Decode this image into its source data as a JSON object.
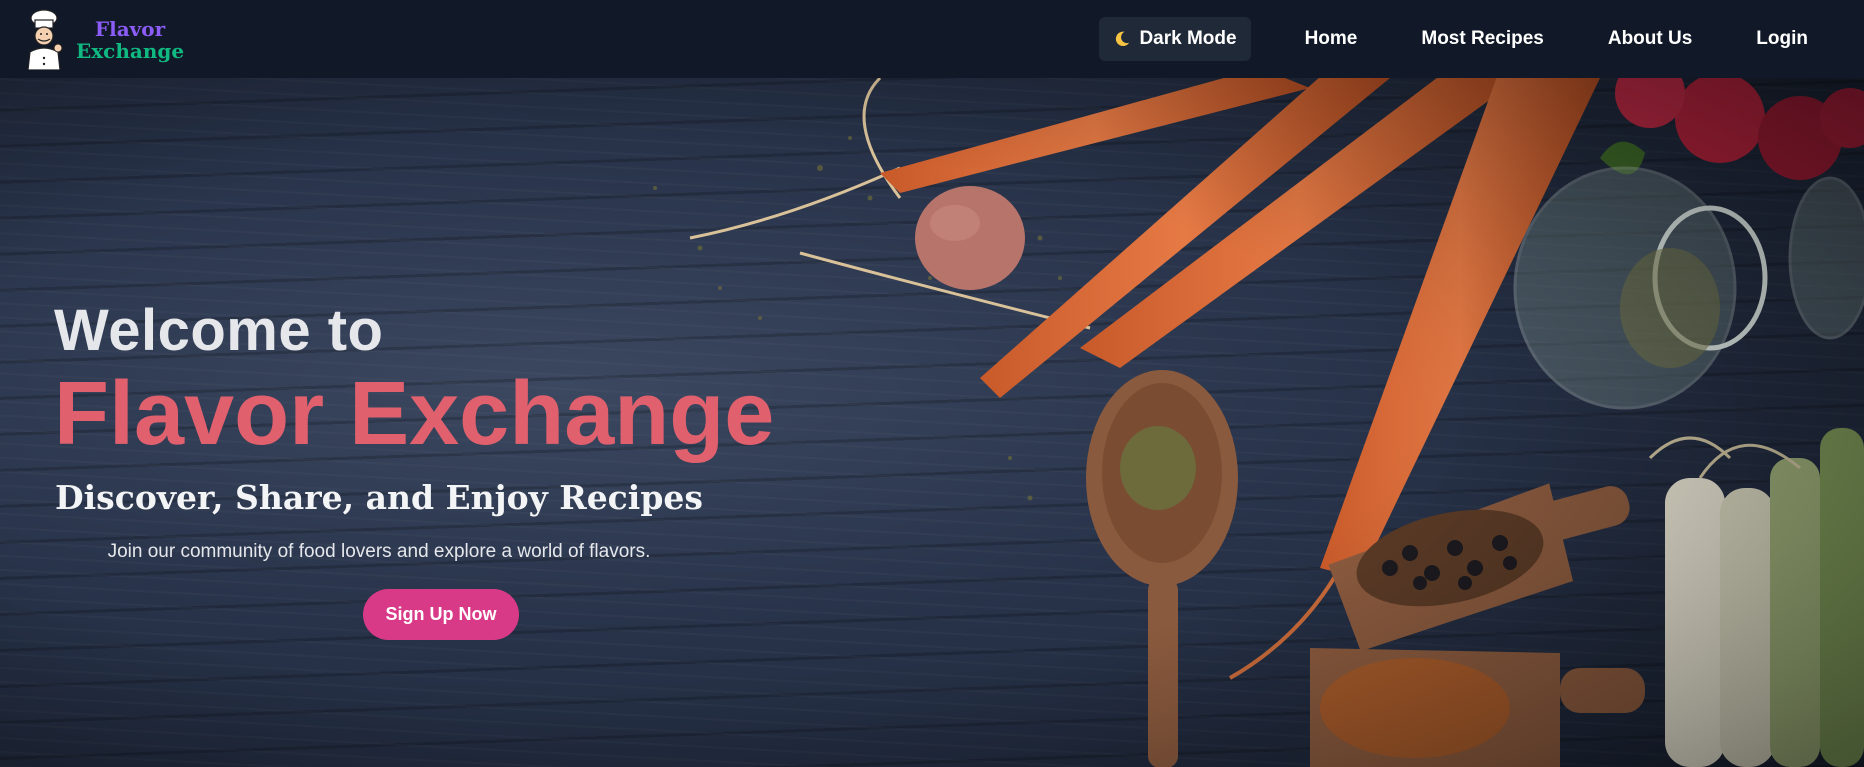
{
  "navbar": {
    "logo": {
      "line1": "Flavor",
      "line2": "Exchange",
      "icon": "chef-icon"
    },
    "dark_mode": {
      "label": "Dark Mode",
      "icon": "moon-icon"
    },
    "links": [
      "Home",
      "Most Recipes",
      "About Us",
      "Login"
    ]
  },
  "hero": {
    "welcome": "Welcome to",
    "title": "Flavor Exchange",
    "tagline": "Discover, Share, and Enjoy Recipes",
    "subtext": "Join our community of food lovers and explore a world of flavors.",
    "cta": "Sign Up Now"
  },
  "colors": {
    "navbar_bg": "#111827",
    "logo_purple": "#8b5cf6",
    "logo_green": "#10b981",
    "title_pink": "#e0606e",
    "cta_pink": "#d93a88"
  }
}
